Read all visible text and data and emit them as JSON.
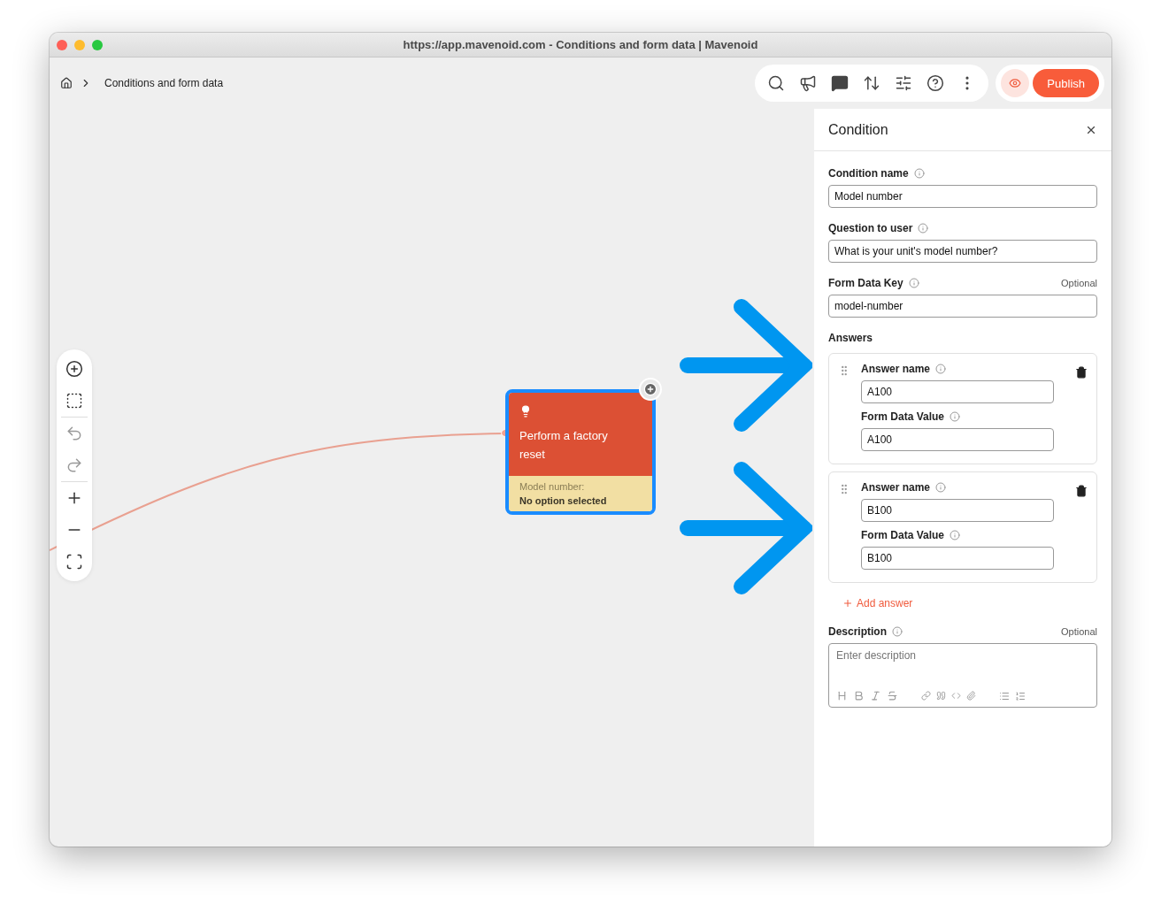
{
  "window": {
    "title": "https://app.mavenoid.com - Conditions and form data | Mavenoid"
  },
  "breadcrumb": {
    "label": "Conditions and form data"
  },
  "publish": {
    "label": "Publish"
  },
  "node": {
    "title": "Perform a factory reset",
    "detail_label": "Model number:",
    "detail_value": "No option selected",
    "selected": true
  },
  "panel": {
    "title": "Condition",
    "fields": [
      {
        "label": "Condition name",
        "value": "Model number"
      },
      {
        "label": "Question to user",
        "value": "What is your unit's model number?"
      },
      {
        "label": "Form Data Key",
        "note": "Optional",
        "value": "model-number"
      }
    ],
    "answers_label": "Answers",
    "answers": [
      {
        "name_label": "Answer name",
        "name_value": "A100",
        "value_label": "Form Data Value",
        "value": "A100"
      },
      {
        "name_label": "Answer name",
        "name_value": "B100",
        "value_label": "Form Data Value",
        "value": "B100"
      }
    ],
    "add_answer": "Add answer",
    "description": {
      "label": "Description",
      "note": "Optional",
      "placeholder": "Enter description"
    }
  }
}
